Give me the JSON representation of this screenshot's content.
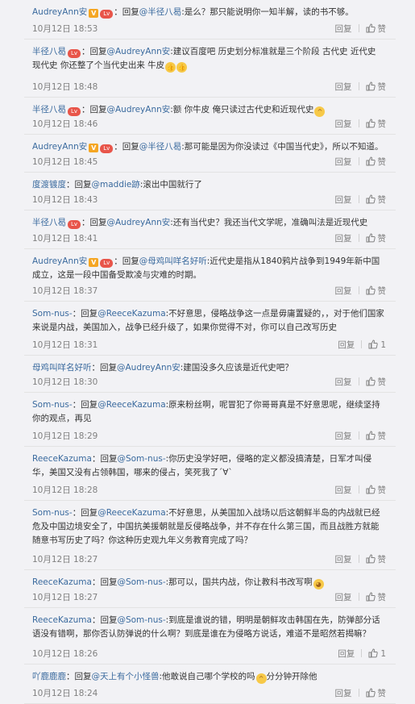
{
  "colors": {
    "user": "#3a6a9e",
    "text": "#333333",
    "meta": "#808080",
    "bg": "#f2f2f5"
  },
  "icons": {
    "thumb": "thumbs-up-icon",
    "vip": "vip-badge-icon",
    "level": "level-badge-icon",
    "emoji": "emoji-icon"
  },
  "comments": [
    {
      "user": "AudreyAnn安",
      "badges": [
        "v",
        "lv"
      ],
      "prefix": "：回复",
      "at": "@半径八曷",
      "text": ":是么？那只能说明你一知半解，读的书不够。",
      "time": "10月12日 18:53",
      "reply": "回复",
      "like": "赞"
    },
    {
      "user": "半径八曷",
      "badges": [
        "lv"
      ],
      "prefix": "：回复",
      "at": "@AudreyAnn安",
      "text": ":建议百度吧 历史划分标准就是三个阶段 古代史 近代史 现代史 你还整了个当代史出来 牛皮",
      "emoji": [
        "thumb",
        "thumb"
      ],
      "time": "10月12日 18:48",
      "reply": "回复",
      "like": "赞"
    },
    {
      "user": "半径八曷",
      "badges": [
        "lv"
      ],
      "prefix": "：回复",
      "at": "@AudreyAnn安",
      "text": ":额 你牛皮 俺只读过古代史和近现代史",
      "emoji": [
        "grin"
      ],
      "time": "10月12日 18:46",
      "reply": "回复",
      "like": "赞"
    },
    {
      "user": "AudreyAnn安",
      "badges": [
        "v",
        "lv"
      ],
      "prefix": "：回复",
      "at": "@半径八曷",
      "text": ":那可能是因为你没读过《中国当代史》，所以不知道。",
      "time": "10月12日 18:45",
      "reply": "回复",
      "like": "赞"
    },
    {
      "user": "度渡镀度",
      "badges": [],
      "prefix": "：回复",
      "at": "@maddie跡",
      "text": ":滚出中国就行了",
      "time": "10月12日 18:43",
      "reply": "回复",
      "like": "赞"
    },
    {
      "user": "半径八曷",
      "badges": [
        "lv"
      ],
      "prefix": "：回复",
      "at": "@AudreyAnn安",
      "text": ":还有当代史？我还当代文学呢，准确叫法是近现代史",
      "time": "10月12日 18:41",
      "reply": "回复",
      "like": "赞"
    },
    {
      "user": "AudreyAnn安",
      "badges": [
        "v",
        "lv"
      ],
      "prefix": "：回复",
      "at": "@母鸡叫咩名好听",
      "text": ":近代史是指从1840鸦片战争到1949年新中国成立，这是一段中国备受欺凌与灾难的时期。",
      "time": "10月12日 18:37",
      "reply": "回复",
      "like": "赞"
    },
    {
      "user": "Som-nus-",
      "badges": [],
      "prefix": "：回复",
      "at": "@ReeceKazuma",
      "text": ":不好意思，侵略战争这一点是毋庸置疑的，，对于他们国家来说是内战，美国加入，战争已经升级了，如果你觉得不对，你可以自己改写历史",
      "time": "10月12日 18:31",
      "reply": "回复",
      "like": "1"
    },
    {
      "user": "母鸡叫咩名好听",
      "badges": [],
      "prefix": "：回复",
      "at": "@AudreyAnn安",
      "text": ":建国没多久应该是近代史吧？",
      "time": "10月12日 18:30",
      "reply": "回复",
      "like": "赞"
    },
    {
      "user": "Som-nus-",
      "badges": [],
      "prefix": "：回复",
      "at": "@ReeceKazuma",
      "text": ":原来粉丝啊，呢冒犯了你哥哥真是不好意思呢，继续坚持你的观点，再见",
      "time": "10月12日 18:29",
      "reply": "回复",
      "like": "赞"
    },
    {
      "user": "ReeceKazuma",
      "badges": [],
      "prefix": "：回复",
      "at": "@Som-nus-",
      "text": ":你历史没学好吧，侵略的定义都没搞清楚，日军才叫侵华，美国又没有占领韩国，哪来的侵占，笑死我了ˊ∀ˋ",
      "time": "10月12日 18:28",
      "reply": "回复",
      "like": "赞"
    },
    {
      "user": "Som-nus-",
      "badges": [],
      "prefix": "：回复",
      "at": "@ReeceKazuma",
      "text": ":不好意思，从美国加入战场以后这朝鲜半岛的内战就已经危及中国边境安全了，中国抗美援朝就是反侵略战争，并不存在什么第三国，而且战胜方就能随意书写历史了吗？你这种历史观九年义务教育完成了吗？",
      "time": "10月12日 18:27",
      "reply": "回复",
      "like": "赞"
    },
    {
      "user": "ReeceKazuma",
      "badges": [],
      "prefix": "：回复",
      "at": "@Som-nus-",
      "text": ":那可以，国共内战，你让教科书改写啊",
      "emoji": [
        "cat"
      ],
      "time": "10月12日 18:27",
      "reply": "回复",
      "like": "赞"
    },
    {
      "user": "ReeceKazuma",
      "badges": [],
      "prefix": "：回复",
      "at": "@Som-nus-",
      "text": ":到底是谁说的错，明明是朝鲜攻击韩国在先，防弹部分话语没有错啊，那你否认防弹说的什么啊？到底是谁在为侵略方说话，难道不是昭然若揭嘛？",
      "time": "10月12日 18:26",
      "reply": "回复",
      "like": "1"
    },
    {
      "user": "吖鹿鹿鹿",
      "badges": [],
      "prefix": "：回复",
      "at": "@天上有个小怪兽",
      "text": ":他敢说自己哪个学校的吗",
      "emoji": [
        "laugh"
      ],
      "tail": "分分钟开除他",
      "time": "10月12日 18:24",
      "reply": "回复",
      "like": "赞"
    }
  ]
}
